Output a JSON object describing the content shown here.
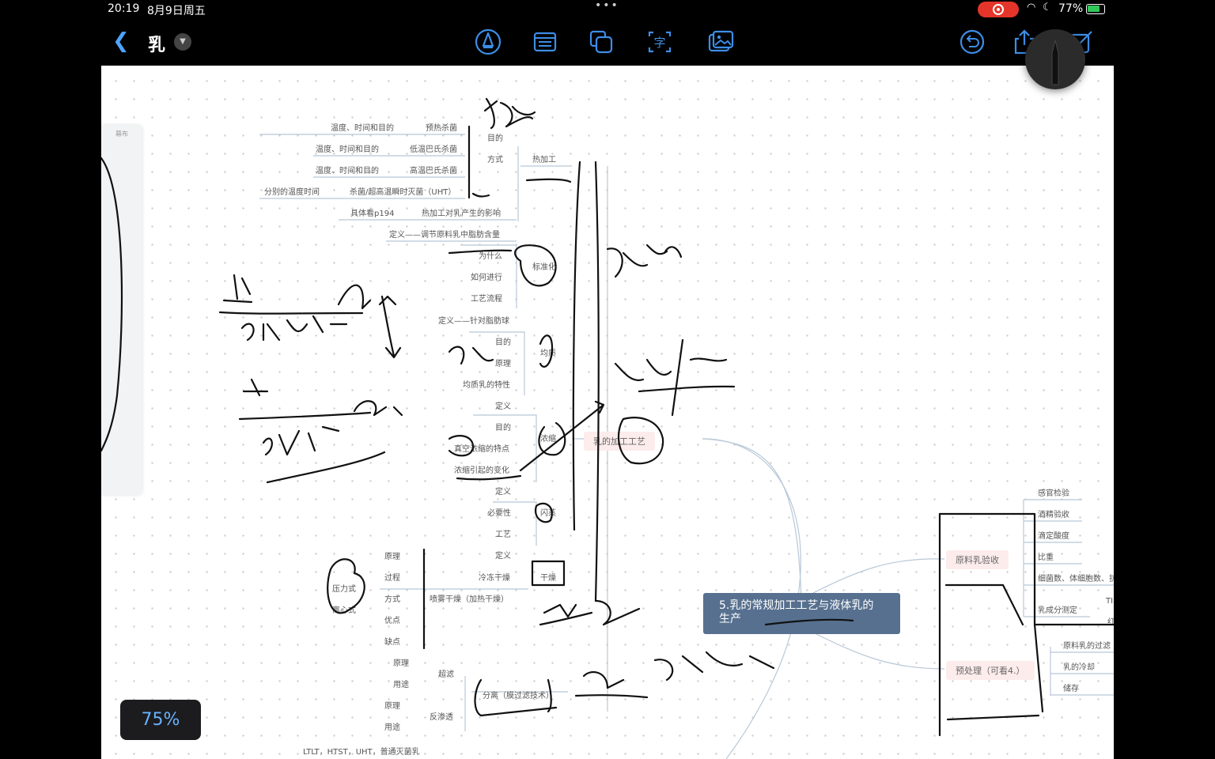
{
  "status_bar": {
    "time": "20:19",
    "date": "8月9日周五",
    "dots": "•••",
    "battery_percent": "77%",
    "battery_level": 0.77
  },
  "toolbar": {
    "back_icon": "chevron-left-icon",
    "title": "乳",
    "title_menu_icon": "chevron-down-icon",
    "tools": [
      "pen-tool-icon",
      "note-icon",
      "layers-icon",
      "text-recognition-icon",
      "image-icon"
    ],
    "right_tools": [
      "undo-icon",
      "share-icon",
      "edit-icon"
    ]
  },
  "side_panel": {
    "label": "幕布"
  },
  "zoom": {
    "label": "75%"
  },
  "mindmap": {
    "root": "5.乳的常规加工工艺与液体乳的生产",
    "center": "乳的加工工艺",
    "heat": {
      "label": "热加工",
      "branches": [
        "目的",
        "方式"
      ],
      "methods": [
        "预热杀菌",
        "低温巴氏杀菌",
        "高温巴氏杀菌",
        "杀菌/超高温瞬时灭菌（UHT）"
      ],
      "method_notes": [
        "温度、时间和目的",
        "温度、时间和目的",
        "温度、时间和目的",
        "分别的温度时间"
      ],
      "effect": "热加工对乳产生的影响",
      "effect_note": "具体看p194"
    },
    "standardize": {
      "label": "标准化",
      "def": "定义——调节原料乳中脂肪含量",
      "items": [
        "为什么",
        "如何进行",
        "工艺流程"
      ]
    },
    "homogenize": {
      "label": "均质",
      "def": "定义——针对脂肪球",
      "items": [
        "目的",
        "原理",
        "均质乳的特性"
      ]
    },
    "concentrate": {
      "label": "浓缩",
      "items": [
        "定义",
        "目的",
        "真空浓缩的特点",
        "浓缩引起的变化"
      ]
    },
    "flash": {
      "label": "闪蒸",
      "items": [
        "定义",
        "必要性",
        "工艺"
      ]
    },
    "dry": {
      "label": "干燥",
      "items": [
        "定义",
        "冷冻干燥",
        "喷雾干燥（加热干燥）"
      ],
      "spray_items": [
        "原理",
        "过程",
        "方式",
        "优点",
        "缺点"
      ],
      "spray_types": [
        "压力式",
        "离心式"
      ]
    },
    "separate": {
      "label": "分离（膜过滤技术）",
      "items": [
        "超滤",
        "反渗透"
      ],
      "sub_items": [
        "原理",
        "用途"
      ]
    },
    "bottom_note": "LTLT，HTST，UHT，普通灭菌乳",
    "raw_milk": {
      "label": "原料乳验收",
      "items": [
        "感官检验",
        "酒精验收",
        "滴定酸度",
        "比重",
        "细菌数、体细胞数、抗",
        "乳成分测定"
      ],
      "cut": [
        "TI",
        "红"
      ]
    },
    "pretreat": {
      "label": "预处理（可看4.）",
      "items": [
        "原料乳的过滤",
        "乳的冷却",
        "储存"
      ]
    }
  }
}
